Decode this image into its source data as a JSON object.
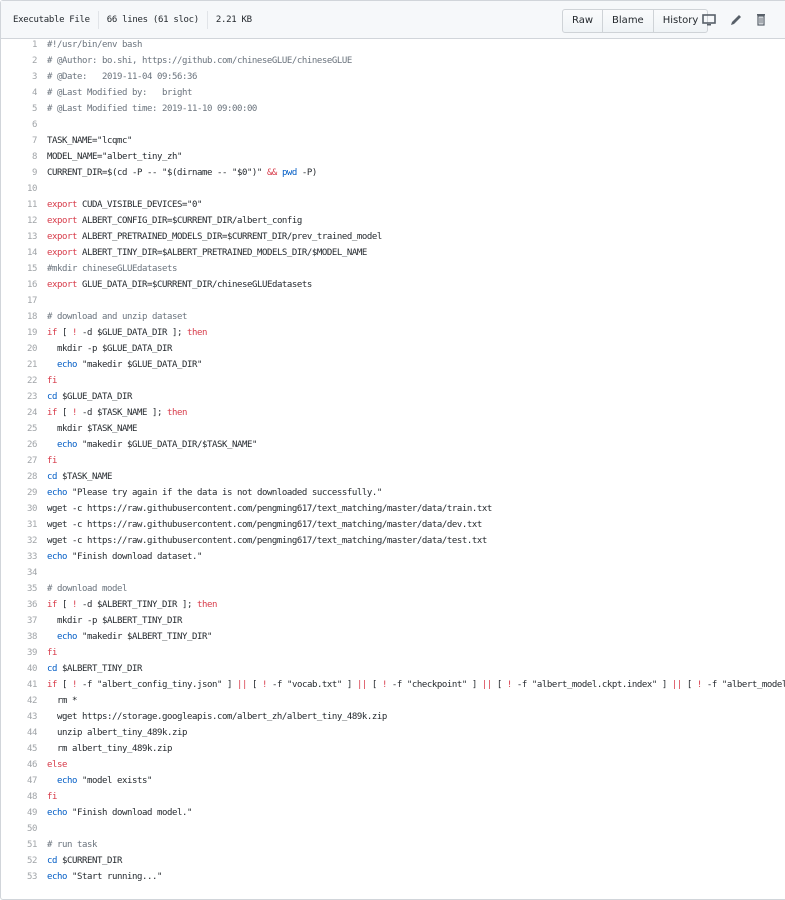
{
  "header": {
    "file_type": "Executable File",
    "lines_info": "66 lines (61 sloc)",
    "size": "2.21 KB",
    "buttons": [
      {
        "label": "Raw"
      },
      {
        "label": "Blame"
      },
      {
        "label": "History"
      }
    ],
    "icons": [
      "desktop-icon",
      "pencil-icon",
      "trash-icon"
    ]
  },
  "colors": {
    "keyword": "#d73a49",
    "builtin": "#005cc5",
    "comment": "#6a737d",
    "text": "#24292e"
  },
  "code_lines": [
    [
      [
        "#!/usr/bin/env bash",
        "c"
      ]
    ],
    [
      [
        "# @Author: bo.shi, https://github.com/chineseGLUE/chineseGLUE",
        "c"
      ]
    ],
    [
      [
        "# @Date:   2019-11-04 09:56:36",
        "c"
      ]
    ],
    [
      [
        "# @Last Modified by:   bright",
        "c"
      ]
    ],
    [
      [
        "# @Last Modified time: 2019-11-10 09:00:00",
        "c"
      ]
    ],
    [],
    [
      [
        "TASK_NAME=\"lcqmc\"",
        ""
      ]
    ],
    [
      [
        "MODEL_NAME=\"albert_tiny_zh\"",
        ""
      ]
    ],
    [
      [
        "CURRENT_DIR=$(cd -P -- \"$(dirname -- \"$0\")\" ",
        ""
      ],
      [
        "&&",
        "k"
      ],
      [
        " ",
        ""
      ],
      [
        "pwd",
        "b"
      ],
      [
        " -P)",
        ""
      ]
    ],
    [],
    [
      [
        "export",
        "k"
      ],
      [
        " CUDA_VISIBLE_DEVICES=\"0\"",
        ""
      ]
    ],
    [
      [
        "export",
        "k"
      ],
      [
        " ALBERT_CONFIG_DIR=$CURRENT_DIR/albert_config",
        ""
      ]
    ],
    [
      [
        "export",
        "k"
      ],
      [
        " ALBERT_PRETRAINED_MODELS_DIR=$CURRENT_DIR/prev_trained_model",
        ""
      ]
    ],
    [
      [
        "export",
        "k"
      ],
      [
        " ALBERT_TINY_DIR=$ALBERT_PRETRAINED_MODELS_DIR/$MODEL_NAME",
        ""
      ]
    ],
    [
      [
        "#mkdir chineseGLUEdatasets",
        "c"
      ]
    ],
    [
      [
        "export",
        "k"
      ],
      [
        " GLUE_DATA_DIR=$CURRENT_DIR/chineseGLUEdatasets",
        ""
      ]
    ],
    [],
    [
      [
        "# download and unzip dataset",
        "c"
      ]
    ],
    [
      [
        "if",
        "k"
      ],
      [
        " [ ",
        ""
      ],
      [
        "!",
        "k"
      ],
      [
        " -d $GLUE_DATA_DIR ]; ",
        ""
      ],
      [
        "then",
        "k"
      ]
    ],
    [
      [
        "  mkdir -p $GLUE_DATA_DIR",
        ""
      ]
    ],
    [
      [
        "  ",
        ""
      ],
      [
        "echo",
        "b"
      ],
      [
        " \"makedir $GLUE_DATA_DIR\"",
        ""
      ]
    ],
    [
      [
        "fi",
        "k"
      ]
    ],
    [
      [
        "cd",
        "b"
      ],
      [
        " $GLUE_DATA_DIR",
        ""
      ]
    ],
    [
      [
        "if",
        "k"
      ],
      [
        " [ ",
        ""
      ],
      [
        "!",
        "k"
      ],
      [
        " -d $TASK_NAME ]; ",
        ""
      ],
      [
        "then",
        "k"
      ]
    ],
    [
      [
        "  mkdir $TASK_NAME",
        ""
      ]
    ],
    [
      [
        "  ",
        ""
      ],
      [
        "echo",
        "b"
      ],
      [
        " \"makedir $GLUE_DATA_DIR/$TASK_NAME\"",
        ""
      ]
    ],
    [
      [
        "fi",
        "k"
      ]
    ],
    [
      [
        "cd",
        "b"
      ],
      [
        " $TASK_NAME",
        ""
      ]
    ],
    [
      [
        "echo",
        "b"
      ],
      [
        " \"Please try again if the data is not downloaded successfully.\"",
        ""
      ]
    ],
    [
      [
        "wget -c https://raw.githubusercontent.com/pengming617/text_matching/master/data/train.txt",
        ""
      ]
    ],
    [
      [
        "wget -c https://raw.githubusercontent.com/pengming617/text_matching/master/data/dev.txt",
        ""
      ]
    ],
    [
      [
        "wget -c https://raw.githubusercontent.com/pengming617/text_matching/master/data/test.txt",
        ""
      ]
    ],
    [
      [
        "echo",
        "b"
      ],
      [
        " \"Finish download dataset.\"",
        ""
      ]
    ],
    [],
    [
      [
        "# download model",
        "c"
      ]
    ],
    [
      [
        "if",
        "k"
      ],
      [
        " [ ",
        ""
      ],
      [
        "!",
        "k"
      ],
      [
        " -d $ALBERT_TINY_DIR ]; ",
        ""
      ],
      [
        "then",
        "k"
      ]
    ],
    [
      [
        "  mkdir -p $ALBERT_TINY_DIR",
        ""
      ]
    ],
    [
      [
        "  ",
        ""
      ],
      [
        "echo",
        "b"
      ],
      [
        " \"makedir $ALBERT_TINY_DIR\"",
        ""
      ]
    ],
    [
      [
        "fi",
        "k"
      ]
    ],
    [
      [
        "cd",
        "b"
      ],
      [
        " $ALBERT_TINY_DIR",
        ""
      ]
    ],
    [
      [
        "if",
        "k"
      ],
      [
        " [ ",
        ""
      ],
      [
        "!",
        "k"
      ],
      [
        " -f \"albert_config_tiny.json\" ] ",
        ""
      ],
      [
        "||",
        "k"
      ],
      [
        " [ ",
        ""
      ],
      [
        "!",
        "k"
      ],
      [
        " -f \"vocab.txt\" ] ",
        ""
      ],
      [
        "||",
        "k"
      ],
      [
        " [ ",
        ""
      ],
      [
        "!",
        "k"
      ],
      [
        " -f \"checkpoint\" ] ",
        ""
      ],
      [
        "||",
        "k"
      ],
      [
        " [ ",
        ""
      ],
      [
        "!",
        "k"
      ],
      [
        " -f \"albert_model.ckpt.index\" ] ",
        ""
      ],
      [
        "||",
        "k"
      ],
      [
        " [ ",
        ""
      ],
      [
        "!",
        "k"
      ],
      [
        " -f \"albert_model",
        ""
      ]
    ],
    [
      [
        "  rm *",
        ""
      ]
    ],
    [
      [
        "  wget https://storage.googleapis.com/albert_zh/albert_tiny_489k.zip",
        ""
      ]
    ],
    [
      [
        "  unzip albert_tiny_489k.zip",
        ""
      ]
    ],
    [
      [
        "  rm albert_tiny_489k.zip",
        ""
      ]
    ],
    [
      [
        "else",
        "k"
      ]
    ],
    [
      [
        "  ",
        ""
      ],
      [
        "echo",
        "b"
      ],
      [
        " \"model exists\"",
        ""
      ]
    ],
    [
      [
        "fi",
        "k"
      ]
    ],
    [
      [
        "echo",
        "b"
      ],
      [
        " \"Finish download model.\"",
        ""
      ]
    ],
    [],
    [
      [
        "# run task",
        "c"
      ]
    ],
    [
      [
        "cd",
        "b"
      ],
      [
        " $CURRENT_DIR",
        ""
      ]
    ],
    [
      [
        "echo",
        "b"
      ],
      [
        " \"Start running...\"",
        ""
      ]
    ]
  ]
}
